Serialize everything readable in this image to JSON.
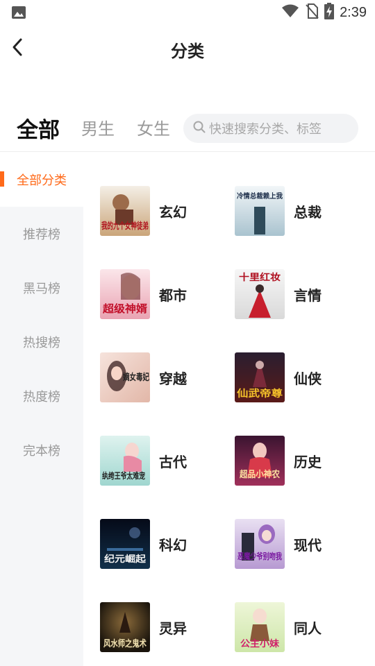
{
  "status_bar": {
    "time": "2:39"
  },
  "header": {
    "title": "分类"
  },
  "tabs": [
    {
      "label": "全部"
    },
    {
      "label": "男生"
    },
    {
      "label": "女生"
    }
  ],
  "search": {
    "placeholder": "快速搜索分类、标签"
  },
  "sidebar": {
    "items": [
      {
        "label": "全部分类"
      },
      {
        "label": "推荐榜"
      },
      {
        "label": "黑马榜"
      },
      {
        "label": "热搜榜"
      },
      {
        "label": "热度榜"
      },
      {
        "label": "完本榜"
      }
    ]
  },
  "categories": [
    {
      "label": "玄幻",
      "cover_text": "我的九个女神徒弟"
    },
    {
      "label": "总裁",
      "cover_text": "冷情总裁赖上我"
    },
    {
      "label": "都市",
      "cover_text": "超级神婿"
    },
    {
      "label": "言情",
      "cover_text": "十里红妆"
    },
    {
      "label": "穿越",
      "cover_text": "嫡女毒妃"
    },
    {
      "label": "仙侠",
      "cover_text": "仙武帝尊"
    },
    {
      "label": "古代",
      "cover_text": "纨绔王爷太难宠"
    },
    {
      "label": "历史",
      "cover_text": "超品小神农"
    },
    {
      "label": "科幻",
      "cover_text": "纪元崛起"
    },
    {
      "label": "现代",
      "cover_text": "恶魔少爷别吻我"
    },
    {
      "label": "灵异",
      "cover_text": "风水师之鬼术"
    },
    {
      "label": "同人",
      "cover_text": "公主小妹"
    }
  ],
  "colors": {
    "accent": "#ff6a1a",
    "sidebar_bg": "#f5f6f8",
    "search_bg": "#f2f3f5"
  }
}
